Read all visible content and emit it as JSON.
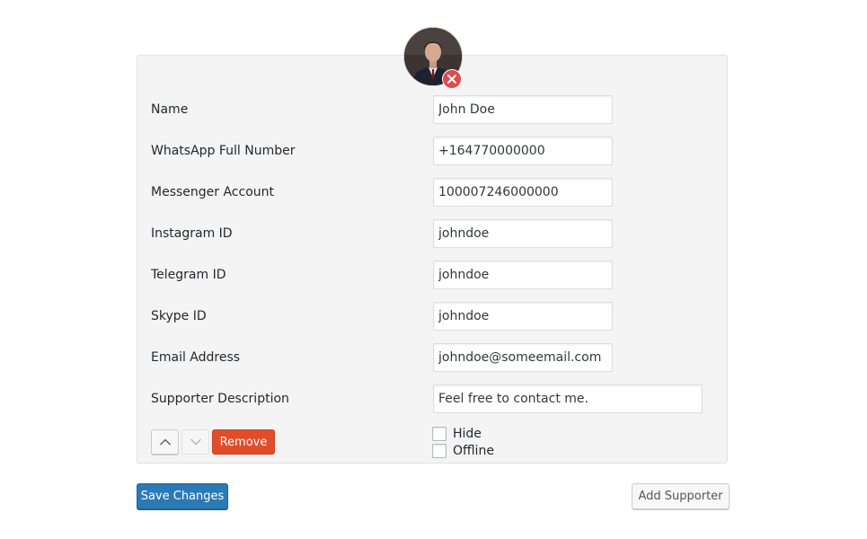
{
  "supporter": {
    "fields": [
      {
        "label": "Name",
        "value": "John Doe"
      },
      {
        "label": "WhatsApp Full Number",
        "value": "+164770000000"
      },
      {
        "label": "Messenger Account",
        "value": "100007246000000"
      },
      {
        "label": "Instagram ID",
        "value": "johndoe"
      },
      {
        "label": "Telegram ID",
        "value": "johndoe"
      },
      {
        "label": "Skype ID",
        "value": "johndoe"
      },
      {
        "label": "Email Address",
        "value": "johndoe@someemail.com"
      },
      {
        "label": "Supporter Description",
        "value": "Feel free to contact me."
      }
    ],
    "remove_label": "Remove",
    "hide_label": "Hide",
    "offline_label": "Offline",
    "hide_checked": false,
    "offline_checked": false,
    "move_down_disabled": true
  },
  "footer": {
    "save_label": "Save Changes",
    "add_label": "Add Supporter"
  },
  "colors": {
    "primary": "#2b7ab5",
    "danger": "#e14d2a",
    "remove_avatar": "#e04a4a",
    "panel_bg": "#f4f4f4"
  },
  "icons": {
    "avatar": "person-photo",
    "avatar_remove": "close-icon",
    "move_up": "chevron-up-icon",
    "move_down": "chevron-down-icon"
  }
}
